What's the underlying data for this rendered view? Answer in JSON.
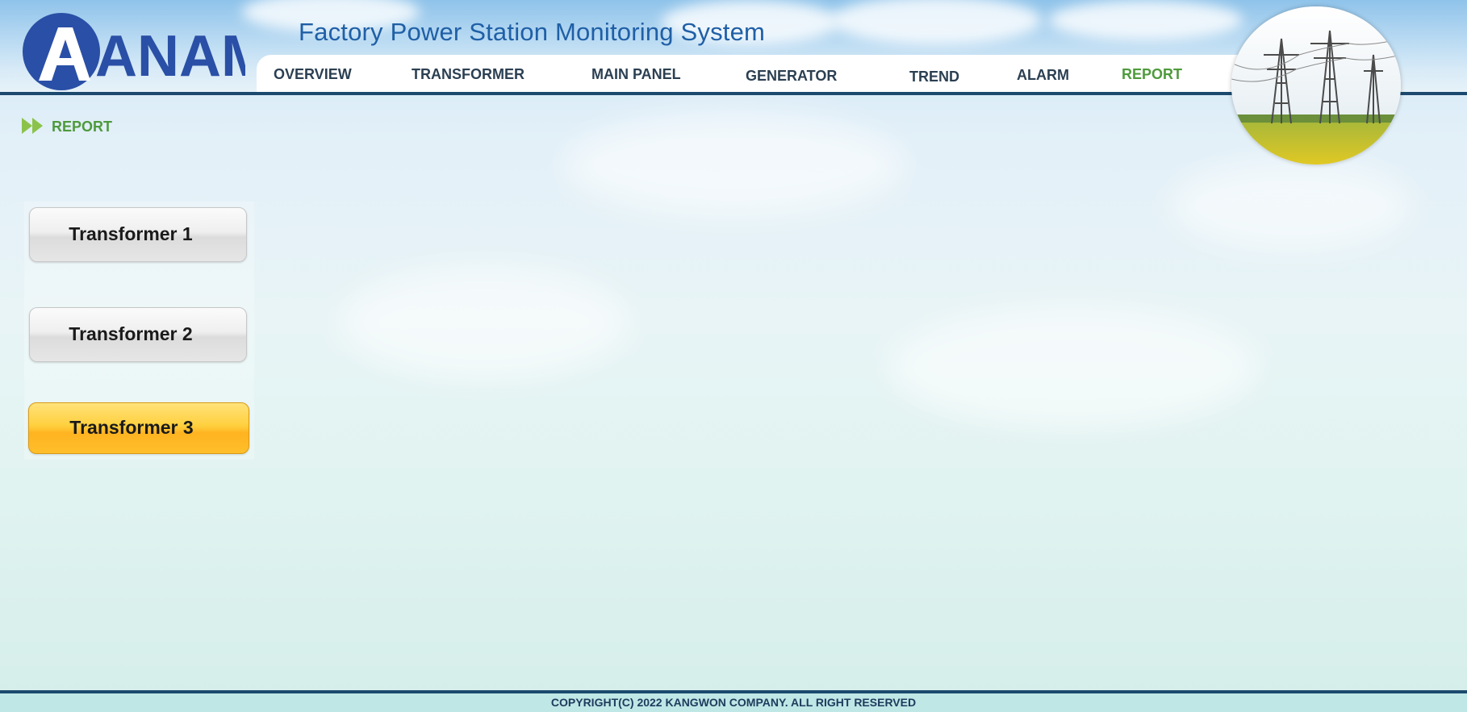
{
  "header": {
    "logo_text": "ANAM",
    "system_title": "Factory Power Station Monitoring System",
    "brand_color": "#2a4fa6"
  },
  "nav": {
    "items": [
      {
        "label": "OVERVIEW"
      },
      {
        "label": "TRANSFORMER"
      },
      {
        "label": "MAIN PANEL"
      },
      {
        "label": "GENERATOR"
      },
      {
        "label": "TREND"
      },
      {
        "label": "ALARM"
      },
      {
        "label": "REPORT",
        "active": true
      }
    ],
    "active_color": "#4e9a3c"
  },
  "breadcrumb": {
    "icon": "double-arrow-icon",
    "label": "REPORT"
  },
  "side_buttons": [
    {
      "label": "Transformer 1",
      "selected": false
    },
    {
      "label": "Transformer 2",
      "selected": false
    },
    {
      "label": "Transformer 3",
      "selected": true
    }
  ],
  "footer": {
    "copyright": "COPYRIGHT(C) 2022 KANGWON COMPANY. ALL RIGHT RESERVED"
  }
}
